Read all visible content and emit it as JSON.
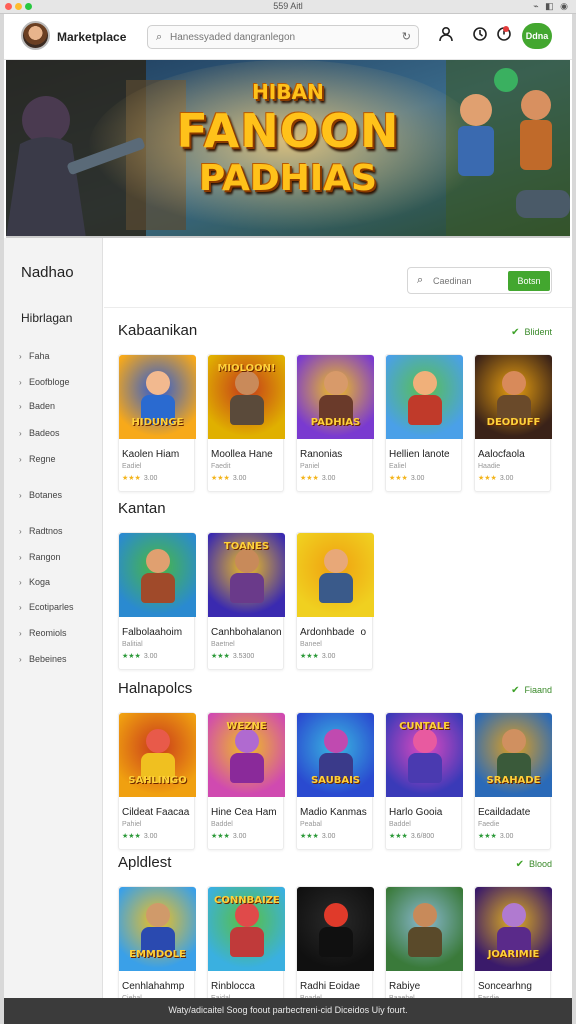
{
  "titlebar": {
    "clock": "559 Aitl",
    "system_icons": "⌁ ◧ ◉"
  },
  "header": {
    "brand": "Marketplace",
    "search_placeholder": "Hanessyaded dangranlegon",
    "icons": [
      "person-search-icon",
      "history-icon",
      "notification-icon",
      "refresh-icon"
    ],
    "account_button": "Ddna"
  },
  "hero": {
    "subtitle": "HIBAN",
    "title": "FANOON",
    "title_2": "PADHIAS"
  },
  "sidebar": {
    "title": "Nadhao",
    "subtitle": "Hibrlagan",
    "items": [
      "Faha",
      "Eoofbloge",
      "Baden",
      "Badeos",
      "Regne",
      "Botanes",
      "Radtnos",
      "Rangon",
      "Koga",
      "Ecotiparles",
      "Reomiols",
      "Bebeines"
    ]
  },
  "filter": {
    "placeholder": "Caedinan",
    "button": "Botsn"
  },
  "sections": [
    {
      "title": "Kabaanikan",
      "link": "Blident",
      "cards": [
        {
          "title": "Kaolen Hiam",
          "dev": "Eadiel",
          "stars": "★★★",
          "rating": "3.00",
          "banner": "HIDUNGE",
          "theme": [
            "#f7a91a",
            "#2a5ad6"
          ],
          "skin": "#f2b98f",
          "body": "#2a6ad0"
        },
        {
          "title": "Moollea Hane",
          "dev": "Faedit",
          "stars": "★★★",
          "rating": "3.00",
          "banner": "MIOLOON!",
          "theme": [
            "#e0b000",
            "#c43a1a"
          ],
          "skin": "#c98a5a",
          "body": "#5a4a3a"
        },
        {
          "title": "Ranonias",
          "dev": "Paniel",
          "stars": "★★★",
          "rating": "3.00",
          "banner": "PADHIAS",
          "theme": [
            "#7a3ad0",
            "#f0c020"
          ],
          "skin": "#d89a6a",
          "body": "#6a3a2a"
        },
        {
          "title": "Hellien lanote",
          "dev": "Ealiel",
          "stars": "★★★",
          "rating": "3.00",
          "banner": "",
          "theme": [
            "#4aa0e8",
            "#5ac050"
          ],
          "skin": "#f0b07a",
          "body": "#c03a2a"
        },
        {
          "title": "Aalocfaola",
          "dev": "Haadie",
          "stars": "★★★",
          "rating": "3.00",
          "banner": "DEODUFF",
          "theme": [
            "#3a2218",
            "#e8a010"
          ],
          "skin": "#d88a5a",
          "body": "#6a4a2a"
        }
      ]
    },
    {
      "title": "Kantan",
      "link": "",
      "cards": [
        {
          "title": "Falbolaahoim",
          "dev": "Balitial",
          "stars": "★★★",
          "rating": "3.00",
          "banner": "",
          "theme": [
            "#2a8ad0",
            "#4ab840"
          ],
          "skin": "#e0a070",
          "body": "#a04a2a",
          "green": true
        },
        {
          "title": "Canhbohalanon",
          "dev": "Baetnel",
          "stars": "★★★",
          "rating": "3.5300",
          "banner": "TOANES",
          "theme": [
            "#3a2ab0",
            "#f0c020"
          ],
          "skin": "#c88a5a",
          "body": "#6a3a8a",
          "green": true
        },
        {
          "title": "Ardonhbade",
          "dev": "Baneel",
          "stars": "★★★",
          "rating": "3.00",
          "banner": "",
          "theme": [
            "#f0d020",
            "#f0a010"
          ],
          "skin": "#e8a878",
          "body": "#3a5a8a",
          "green": true,
          "tag": "o"
        }
      ]
    },
    {
      "title": "Halnapolcs",
      "link": "Fiaand",
      "cards": [
        {
          "title": "Cildeat Faacaa",
          "dev": "Pahiel",
          "stars": "★★★",
          "rating": "3.00",
          "banner": "SAHLINGO",
          "theme": [
            "#f0a010",
            "#c83a1a"
          ],
          "skin": "#e85a4a",
          "body": "#f0c020",
          "green": true
        },
        {
          "title": "Hine Cea Ham",
          "dev": "Baddel",
          "stars": "★★★",
          "rating": "3.00",
          "banner": "WEZNE",
          "theme": [
            "#d04ab0",
            "#f0c020"
          ],
          "skin": "#b06ad0",
          "body": "#8a2a9a",
          "green": true
        },
        {
          "title": "Madio Kanmas",
          "dev": "Peabal",
          "stars": "★★★",
          "rating": "3.00",
          "banner": "SAUBAIS",
          "theme": [
            "#2a4ad0",
            "#3ab8e0"
          ],
          "skin": "#c04ab0",
          "body": "#3a3a8a",
          "green": true
        },
        {
          "title": "Harlo Gooia",
          "dev": "Baddel",
          "stars": "★★★",
          "rating": "3.6/800",
          "banner": "CUNTALE",
          "theme": [
            "#3a3ab8",
            "#e04ac0"
          ],
          "skin": "#e85aa0",
          "body": "#4a3ab0",
          "green": true
        },
        {
          "title": "Ecaildadate",
          "dev": "Faedie",
          "stars": "★★★",
          "rating": "3.00",
          "banner": "SRAHADE",
          "theme": [
            "#2a6ab8",
            "#e0a020"
          ],
          "skin": "#d09060",
          "body": "#3a5a3a",
          "green": true
        }
      ]
    },
    {
      "title": "Apldlest",
      "link": "Blood",
      "cards": [
        {
          "title": "Cenhlahahmp",
          "dev": "Ciebal",
          "stars": "★★★",
          "rating": "3.00",
          "banner": "EMMDOLE",
          "theme": [
            "#3aa0e8",
            "#f0c020"
          ],
          "skin": "#d09a6a",
          "body": "#2a4ab0"
        },
        {
          "title": "Rinblocca",
          "dev": "Eaidal",
          "stars": "★★★",
          "rating": "3.00",
          "banner": "CONNBAIZE",
          "theme": [
            "#3ab0e0",
            "#5ac040"
          ],
          "skin": "#e04a4a",
          "body": "#c03a3a"
        },
        {
          "title": "Radhi Eoidae",
          "dev": "Boadel",
          "stars": "★★★",
          "rating": "3.00",
          "banner": "",
          "theme": [
            "#101010",
            "#2a2a2a"
          ],
          "skin": "#e03a2a",
          "body": "#101010"
        },
        {
          "title": "Rabiye",
          "dev": "Baaehel",
          "stars": "★★★",
          "rating": "3.00",
          "banner": "",
          "theme": [
            "#3a7a3a",
            "#8ab8d0"
          ],
          "skin": "#c88a5a",
          "body": "#5a4a2a"
        },
        {
          "title": "Soncearhng",
          "dev": "Fasdie",
          "stars": "★★★",
          "rating": "3.2600",
          "banner": "JOARIMIE",
          "theme": [
            "#3a1a6a",
            "#e0b020"
          ],
          "skin": "#b07ad0",
          "body": "#5a2a8a"
        }
      ]
    }
  ],
  "footer": {
    "text": "Waty/adicaitel Soog foout parbectreni-cid Diceidos Uiy fourt."
  },
  "colors": {
    "accent": "#43a72f",
    "notif": "#e23b3b",
    "star": "#f3b51d",
    "star_green": "#2d9a3a"
  }
}
